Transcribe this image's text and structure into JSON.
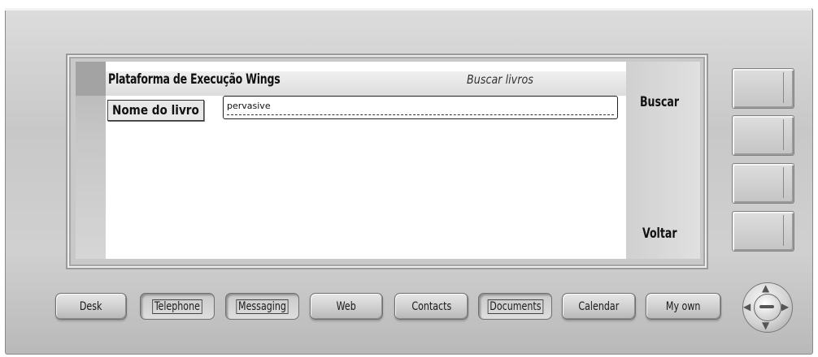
{
  "app": {
    "title": "Plataforma de Execução Wings",
    "screen_title": "Buscar livros"
  },
  "form": {
    "book_label": "Nome do livro",
    "book_value": "pervasive"
  },
  "softkeys": {
    "top": "Buscar",
    "bottom": "Voltar"
  },
  "app_buttons": [
    {
      "label": "Desk"
    },
    {
      "label": "Telephone"
    },
    {
      "label": "Messaging"
    },
    {
      "label": "Web"
    },
    {
      "label": "Contacts"
    },
    {
      "label": "Documents"
    },
    {
      "label": "Calendar"
    },
    {
      "label": "My own"
    }
  ],
  "colors": {
    "device_body": "#cfcfcf",
    "screen_bg": "#ffffff",
    "text": "#111111"
  },
  "icons": {
    "dpad": "navigation-dpad-icon"
  }
}
